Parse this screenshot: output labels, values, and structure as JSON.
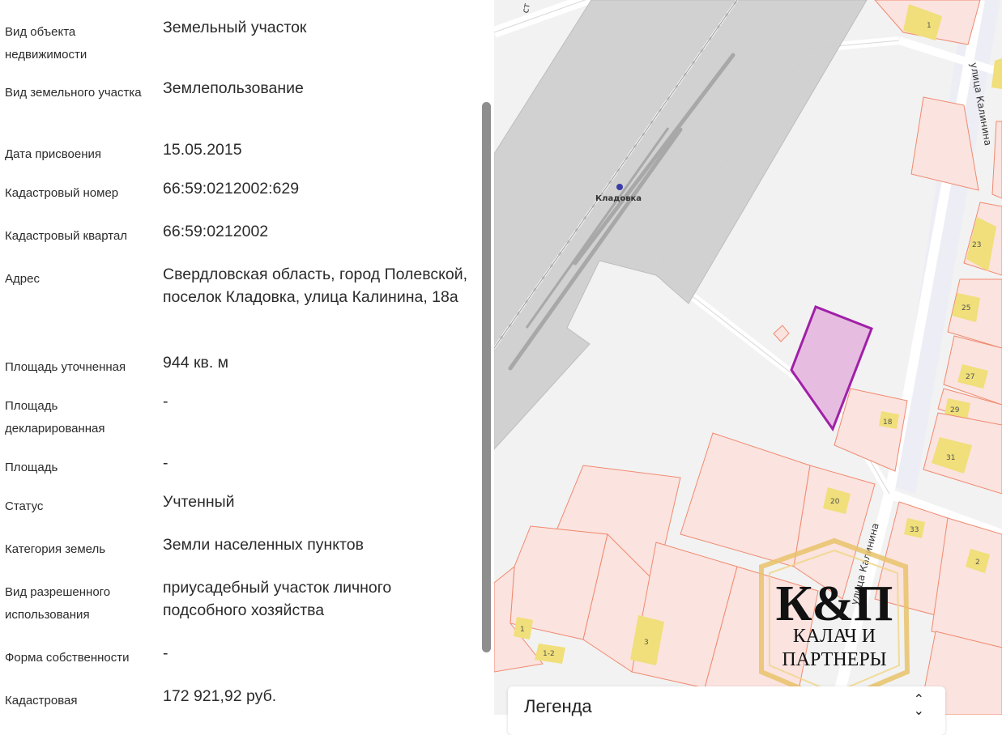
{
  "properties": [
    {
      "label": "Вид объекта недвижимости",
      "value": "Земельный участок"
    },
    {
      "label": "Вид земельного участка",
      "value": "Землепользование"
    },
    {
      "label": "Дата присвоения",
      "value": "15.05.2015"
    },
    {
      "label": "Кадастровый номер",
      "value": "66:59:0212002:629"
    },
    {
      "label": "Кадастровый квартал",
      "value": "66:59:0212002"
    },
    {
      "label": "Адрес",
      "value": "Свердловская область, город Полевской, поселок Кладовка, улица Калинина, 18а"
    },
    {
      "label": "Площадь уточненная",
      "value": "944 кв. м"
    },
    {
      "label": "Площадь декларированная",
      "value": "-"
    },
    {
      "label": "Площадь",
      "value": "-"
    },
    {
      "label": "Статус",
      "value": "Учтенный"
    },
    {
      "label": "Категория земель",
      "value": "Земли населенных пунктов"
    },
    {
      "label": "Вид разрешенного использования",
      "value": "приусадебный участок личного подсобного хозяйства"
    },
    {
      "label": "Форма собственности",
      "value": "-"
    },
    {
      "label": "Кадастровая",
      "value": "172 921,92 руб."
    }
  ],
  "map": {
    "station_label": "Кладовка",
    "street_label_top": "улица Калинина",
    "street_label_bottom": "улица Калинина",
    "top_left_fragment": "ст",
    "parcel_numbers": [
      "1",
      "23",
      "25",
      "27",
      "29",
      "31",
      "18",
      "20",
      "33",
      "2",
      "1",
      "1-2",
      "3"
    ],
    "colors": {
      "selected_parcel_fill": "#e6bde0",
      "selected_parcel_stroke": "#a020a8",
      "parcel_fill": "#fbe3df",
      "parcel_stroke": "#f08a70",
      "building": "#f0df7a",
      "railway_zone": "#cfcfcf"
    }
  },
  "watermark": {
    "monogram": "К&П",
    "line1": "КАЛАЧ И",
    "line2": "ПАРТНЕРЫ"
  },
  "legend": {
    "title": "Легенда",
    "toggle_icon": "collapse-chevron-icon"
  }
}
